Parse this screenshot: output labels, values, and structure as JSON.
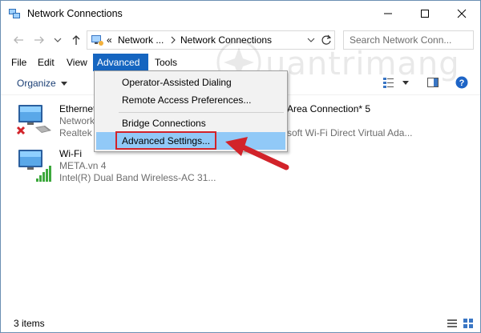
{
  "window": {
    "title": "Network Connections"
  },
  "address": {
    "overflow": "«",
    "crumb1": "Network ...",
    "crumb2": "Network Connections"
  },
  "search": {
    "placeholder": "Search Network Conn..."
  },
  "menubar": {
    "file": "File",
    "edit": "Edit",
    "view": "View",
    "advanced": "Advanced",
    "tools": "Tools"
  },
  "toolbar": {
    "organize": "Organize"
  },
  "advanced_menu": {
    "items": [
      "Operator-Assisted Dialing",
      "Remote Access Preferences...",
      "Bridge Connections",
      "Advanced Settings..."
    ],
    "highlighted": "Advanced Settings..."
  },
  "connections": [
    {
      "name": "Ethernet",
      "status": "Network",
      "device": "Realtek",
      "icon": "ethernet-disconnected-icon"
    },
    {
      "name": "Wi-Fi",
      "status": "META.vn 4",
      "device": "Intel(R) Dual Band Wireless-AC 31...",
      "icon": "wifi-adapter-icon"
    },
    {
      "name": "Area Connection* 5",
      "device": "soft Wi-Fi Direct Virtual Ada...",
      "icon": "virtual-adapter-icon"
    }
  ],
  "status": {
    "count": "3 items"
  },
  "colors": {
    "menu_active": "#1565c0",
    "menu_highlight": "#91c9f7",
    "callout_red": "#d2232a",
    "link_blue": "#1a3e74"
  }
}
